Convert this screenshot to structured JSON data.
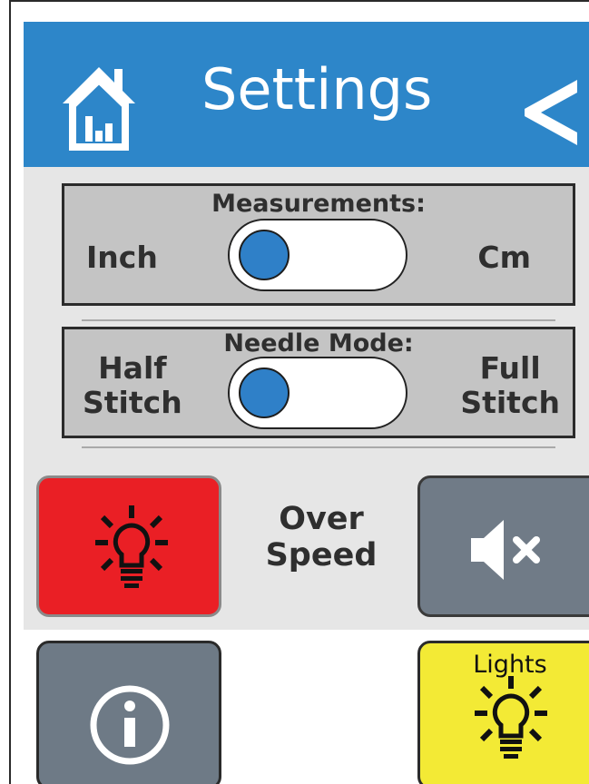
{
  "header": {
    "title": "Settings",
    "home_icon": "home-icon",
    "back_icon": "chevron-left-icon"
  },
  "measurements": {
    "title": "Measurements:",
    "left_label": "Inch",
    "right_label": "Cm",
    "selected": "Inch"
  },
  "needle_mode": {
    "title": "Needle Mode:",
    "left_label_line1": "Half",
    "left_label_line2": "Stitch",
    "right_label_line1": "Full",
    "right_label_line2": "Stitch",
    "selected": "Half Stitch"
  },
  "overspeed": {
    "label_line1": "Over",
    "label_line2": "Speed",
    "indicator_icon": "lightbulb-icon",
    "indicator_color": "#ea1f25"
  },
  "mute": {
    "icon": "speaker-mute-icon"
  },
  "info": {
    "icon": "info-icon"
  },
  "lights": {
    "label": "Lights",
    "icon": "lightbulb-icon",
    "color": "#f3ea35"
  },
  "colors": {
    "header_blue": "#2d86c9",
    "knob_blue": "#2f80c8",
    "panel_gray": "#c4c4c4",
    "button_gray": "#707b87"
  }
}
